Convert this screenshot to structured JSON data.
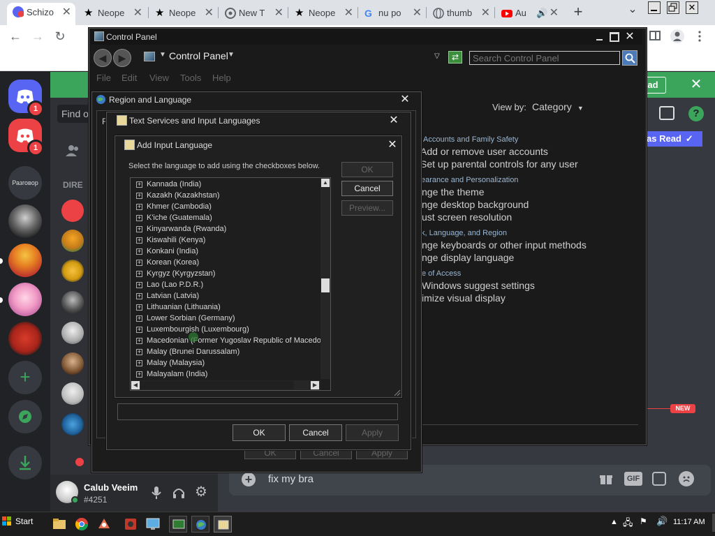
{
  "browser": {
    "tabs": [
      {
        "label": "Schizo",
        "icon": "discord-notification-icon"
      },
      {
        "label": "Neope",
        "icon": "star-icon"
      },
      {
        "label": "Neope",
        "icon": "star-icon"
      },
      {
        "label": "New T",
        "icon": "chrome-icon"
      },
      {
        "label": "Neope",
        "icon": "star-icon"
      },
      {
        "label": "nu po",
        "icon": "google-icon"
      },
      {
        "label": "thumb",
        "icon": "globe-icon"
      },
      {
        "label": "Au",
        "icon": "youtube-icon"
      }
    ],
    "new_tab": "+",
    "tab_search": "⌄"
  },
  "control_panel": {
    "title": "Control Panel",
    "address": "Control Panel",
    "search_placeholder": "Search Control Panel",
    "menu": [
      "File",
      "Edit",
      "View",
      "Tools",
      "Help"
    ],
    "view_by_label": "View by:",
    "view_by_value": "Category",
    "categories": [
      {
        "heading": "Accounts and Family Safety",
        "links": [
          "Add or remove user accounts",
          "Set up parental controls for any user"
        ]
      },
      {
        "heading": "earance and Personalization",
        "links": [
          "nge the theme",
          "nge desktop background",
          "ust screen resolution"
        ]
      },
      {
        "heading": "k, Language, and Region",
        "links": [
          "nge keyboards or other input methods",
          "nge display language"
        ]
      },
      {
        "heading": "e of Access",
        "links": [
          "Windows suggest settings",
          "imize visual display"
        ]
      }
    ]
  },
  "region_dialog": {
    "title": "Region and Language",
    "tab_letter": "F",
    "buttons": [
      "OK",
      "Cancel",
      "Apply"
    ]
  },
  "text_services_dialog": {
    "title": "Text Services and Input Languages",
    "buttons": [
      "OK",
      "Cancel",
      "Apply"
    ]
  },
  "add_language_dialog": {
    "title": "Add Input Language",
    "instruction": "Select the language to add using the checkboxes below.",
    "ok": "OK",
    "cancel": "Cancel",
    "preview": "Preview...",
    "languages": [
      "Kannada (India)",
      "Kazakh (Kazakhstan)",
      "Khmer (Cambodia)",
      "K'iche (Guatemala)",
      "Kinyarwanda (Rwanda)",
      "Kiswahili (Kenya)",
      "Konkani (India)",
      "Korean (Korea)",
      "Kyrgyz (Kyrgyzstan)",
      "Lao (Lao P.D.R.)",
      "Latvian (Latvia)",
      "Lithuanian (Lithuania)",
      "Lower Sorbian (Germany)",
      "Luxembourgish (Luxembourg)",
      "Macedonian (Former Yugoslav Republic of Macedonia)",
      "Malay (Brunei Darussalam)",
      "Malay (Malaysia)",
      "Malayalam (India)"
    ]
  },
  "discord": {
    "badge_count": "1",
    "server_label": "Разговор",
    "find_placeholder": "Find o",
    "direct_label": "DIRE",
    "download_label": "oad",
    "mark_read": "as Read",
    "new_label": "NEW",
    "user": {
      "name": "Calub Veeim",
      "tag": "#4251"
    },
    "message_text": "fix  my bra",
    "gif_label": "GIF"
  },
  "taskbar": {
    "start_label": "Start",
    "clock": "11:17 AM"
  }
}
